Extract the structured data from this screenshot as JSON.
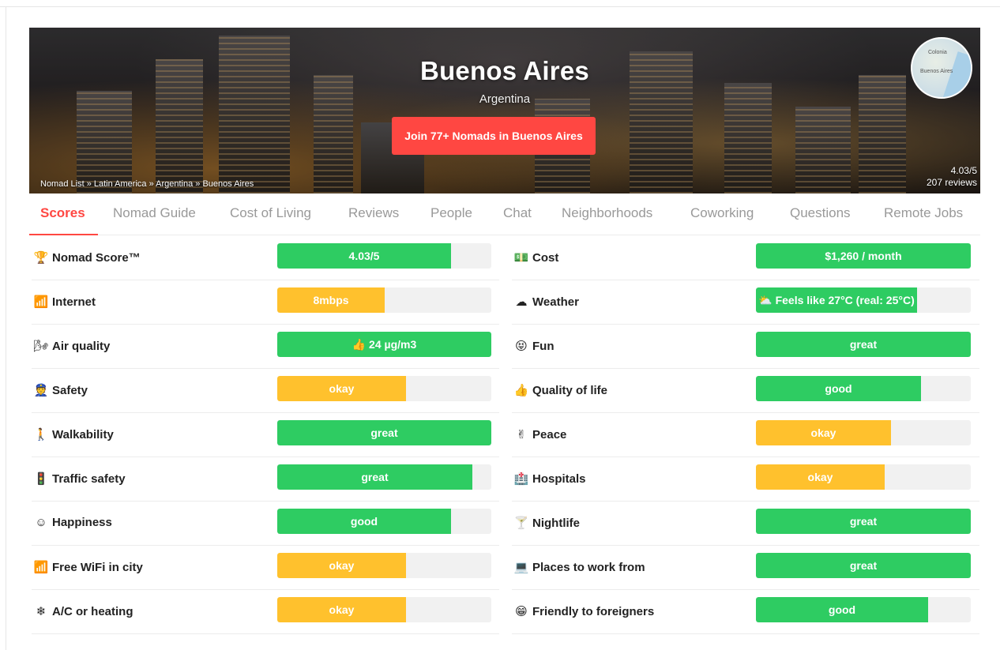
{
  "colors": {
    "green": "#2ecc62",
    "yellow": "#ffc12d",
    "red": "#ff4742",
    "track": "#f1f1f1",
    "tab_inactive": "#999999"
  },
  "hero": {
    "city": "Buenos Aires",
    "country": "Argentina",
    "join_label": "Join 77+ Nomads in Buenos Aires",
    "breadcrumb": "Nomad List » Latin America » Argentina » Buenos Aires",
    "rating": "4.03/5",
    "reviews": "207 reviews",
    "map_label_1": "Colonia",
    "map_label_2": "Buenos Aires"
  },
  "tabs": [
    {
      "label": "Scores",
      "active": true
    },
    {
      "label": "Nomad Guide",
      "active": false
    },
    {
      "label": "Cost of Living",
      "active": false
    },
    {
      "label": "Reviews",
      "active": false
    },
    {
      "label": "People",
      "active": false
    },
    {
      "label": "Chat",
      "active": false
    },
    {
      "label": "Neighborhoods",
      "active": false
    },
    {
      "label": "Coworking",
      "active": false
    },
    {
      "label": "Questions",
      "active": false
    },
    {
      "label": "Remote Jobs",
      "active": false
    }
  ],
  "scores_left": [
    {
      "icon": "trophy-icon",
      "glyph": "🏆",
      "label": "Nomad Score™",
      "value": "4.03/5",
      "fill": 0.81,
      "color": "green"
    },
    {
      "icon": "internet-icon",
      "glyph": "📶",
      "label": "Internet",
      "value": "8mbps",
      "fill": 0.5,
      "color": "yellow"
    },
    {
      "icon": "air-icon",
      "glyph": "🌬",
      "label": "Air quality",
      "value": "👍 24 µg/m3",
      "fill": 1.0,
      "color": "green"
    },
    {
      "icon": "safety-icon",
      "glyph": "👮",
      "label": "Safety",
      "value": "okay",
      "fill": 0.6,
      "color": "yellow"
    },
    {
      "icon": "walk-icon",
      "glyph": "🚶",
      "label": "Walkability",
      "value": "great",
      "fill": 1.0,
      "color": "green"
    },
    {
      "icon": "traffic-light-icon",
      "glyph": "🚦",
      "label": "Traffic safety",
      "value": "great",
      "fill": 0.91,
      "color": "green"
    },
    {
      "icon": "smile-icon",
      "glyph": "☺",
      "label": "Happiness",
      "value": "good",
      "fill": 0.81,
      "color": "green"
    },
    {
      "icon": "wifi-icon",
      "glyph": "📶",
      "label": "Free WiFi in city",
      "value": "okay",
      "fill": 0.6,
      "color": "yellow"
    },
    {
      "icon": "snowflake-icon",
      "glyph": "❄",
      "label": "A/C or heating",
      "value": "okay",
      "fill": 0.6,
      "color": "yellow"
    }
  ],
  "scores_right": [
    {
      "icon": "money-icon",
      "glyph": "💵",
      "label": "Cost",
      "value": "$1,260 / month",
      "fill": 1.0,
      "color": "green"
    },
    {
      "icon": "cloud-icon",
      "glyph": "☁",
      "label": "Weather",
      "value": "⛅ Feels like 27°C (real: 25°C)",
      "fill": 0.75,
      "color": "green"
    },
    {
      "icon": "fun-icon",
      "glyph": "😝",
      "label": "Fun",
      "value": "great",
      "fill": 1.0,
      "color": "green"
    },
    {
      "icon": "thumbs-up-icon",
      "glyph": "👍",
      "label": "Quality of life",
      "value": "good",
      "fill": 0.77,
      "color": "green"
    },
    {
      "icon": "peace-icon",
      "glyph": "✌",
      "label": "Peace",
      "value": "okay",
      "fill": 0.63,
      "color": "yellow"
    },
    {
      "icon": "hospital-icon",
      "glyph": "🏥",
      "label": "Hospitals",
      "value": "okay",
      "fill": 0.6,
      "color": "yellow"
    },
    {
      "icon": "cocktail-icon",
      "glyph": "🍸",
      "label": "Nightlife",
      "value": "great",
      "fill": 1.0,
      "color": "green"
    },
    {
      "icon": "work-icon",
      "glyph": "💻",
      "label": "Places to work from",
      "value": "great",
      "fill": 1.0,
      "color": "green"
    },
    {
      "icon": "friendly-icon",
      "glyph": "😁",
      "label": "Friendly to foreigners",
      "value": "good",
      "fill": 0.8,
      "color": "green"
    }
  ]
}
